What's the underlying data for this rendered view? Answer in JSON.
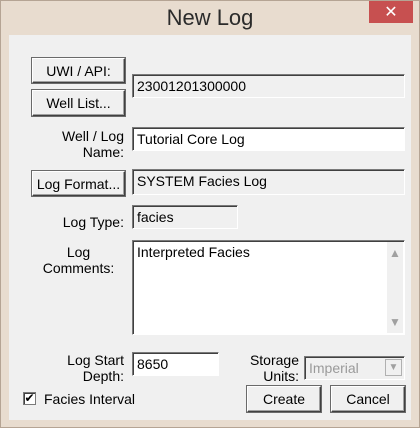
{
  "window": {
    "title": "New Log",
    "close_glyph": "✕"
  },
  "uwi_api_button": "UWI / API:",
  "well_list_button": "Well List...",
  "uwi_value": "23001201300000",
  "well_log_name": {
    "label_line1": "Well / Log",
    "label_line2": "Name:",
    "value": "Tutorial Core Log"
  },
  "log_format": {
    "button": "Log Format...",
    "value": "SYSTEM Facies Log"
  },
  "log_type": {
    "label": "Log Type:",
    "value": "facies"
  },
  "log_comments": {
    "label_line1": "Log",
    "label_line2": "Comments:",
    "value": "Interpreted Facies"
  },
  "log_start_depth": {
    "label_line1": "Log Start",
    "label_line2": "Depth:",
    "value": "8650"
  },
  "storage_units": {
    "label_line1": "Storage",
    "label_line2": "Units:",
    "selected": "Imperial"
  },
  "facies_interval": {
    "label": "Facies Interval",
    "checked": true,
    "check_glyph": "✔"
  },
  "buttons": {
    "create": "Create",
    "cancel": "Cancel"
  },
  "icons": {
    "scroll_up": "▲",
    "scroll_down": "▼",
    "dropdown": "▼"
  }
}
